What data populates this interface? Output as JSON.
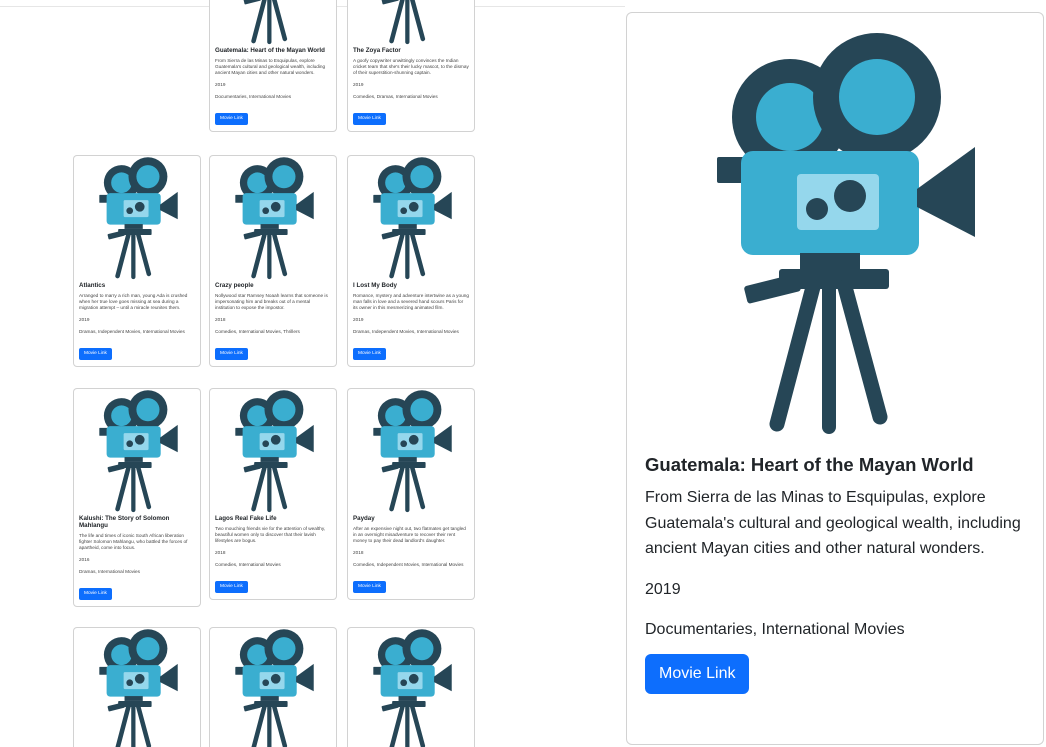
{
  "cards": [
    {
      "title": "Guatemala: Heart of the Mayan World",
      "desc": "From Sierra de las Minas to Esquipulas, explore Guatemala's cultural and geological wealth, including ancient Mayan cities and other natural wonders.",
      "year": "2019",
      "genre": "Documentaries, International Movies",
      "button": "Movie Link"
    },
    {
      "title": "The Zoya Factor",
      "desc": "A goofy copywriter unwittingly convinces the Indian cricket team that she's their lucky mascot, to the dismay of their superstition-shunning captain.",
      "year": "2019",
      "genre": "Comedies, Dramas, International Movies",
      "button": "Movie Link"
    },
    {
      "title": "Atlantics",
      "desc": "Arranged to marry a rich man, young Ada is crushed when her true love goes missing at sea during a migration attempt – until a miracle reunites them.",
      "year": "2019",
      "genre": "Dramas, Independent Movies, International Movies",
      "button": "Movie Link"
    },
    {
      "title": "Crazy people",
      "desc": "Nollywood star Ramsey Noaah learns that someone is impersonating him and breaks out of a mental institution to expose the impostor.",
      "year": "2018",
      "genre": "Comedies, International Movies, Thrillers",
      "button": "Movie Link"
    },
    {
      "title": "I Lost My Body",
      "desc": "Romance, mystery and adventure intertwine as a young man falls in love and a severed hand scours Paris for its owner in this mesmerizing animated film.",
      "year": "2019",
      "genre": "Dramas, Independent Movies, International Movies",
      "button": "Movie Link"
    },
    {
      "title": "Kalushi: The Story of Solomon Mahlangu",
      "desc": "The life and times of iconic South African liberation fighter Solomon Mahlangu, who battled the forces of apartheid, come into focus.",
      "year": "2016",
      "genre": "Dramas, International Movies",
      "button": "Movie Link"
    },
    {
      "title": "Lagos Real Fake Life",
      "desc": "Two mouching friends vie for the attention of wealthy, beautiful women only to discover that their lavish lifestyles are bogus.",
      "year": "2018",
      "genre": "Comedies, International Movies",
      "button": "Movie Link"
    },
    {
      "title": "Payday",
      "desc": "After an expensive night out, two flatmates get tangled in an overnight misadventure to recover their rent money to pay their dead landlord's daughter.",
      "year": "2018",
      "genre": "Comedies, Independent Movies, International Movies",
      "button": "Movie Link"
    }
  ],
  "detail": {
    "title": "Guatemala: Heart of the Mayan World",
    "desc": "From Sierra de las Minas to Esquipulas, explore Guatemala's cultural and geological wealth, including ancient Mayan cities and other natural wonders.",
    "year": "2019",
    "genre": "Documentaries, International Movies",
    "button": "Movie Link"
  },
  "icons": {
    "card_image": "movie-camera-icon"
  },
  "colors": {
    "accent": "#0d6efd",
    "camera_dark": "#264656",
    "camera_light": "#3aaed0",
    "camera_pale": "#95d7ec"
  }
}
